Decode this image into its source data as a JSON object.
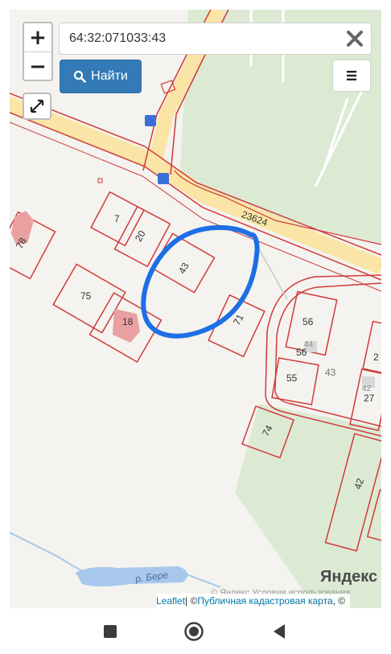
{
  "search": {
    "value": "64:32:071033:43"
  },
  "buttons": {
    "zoom_in": "+",
    "zoom_out": "−",
    "find_label": "Найти"
  },
  "map": {
    "road_label": "23624",
    "river_label": "р. Бере",
    "parcels": [
      "7",
      "20",
      "43",
      "75",
      "18",
      "71",
      "78",
      "56",
      "56",
      "44",
      "43",
      "55",
      "27",
      "42",
      "2",
      "74",
      "42"
    ],
    "parcels_named": {
      "p7": "7",
      "p20": "20",
      "p43": "43",
      "p75": "75",
      "p18": "18",
      "p71": "71",
      "p78": "78",
      "p56a": "56",
      "p56b": "56",
      "p44": "44",
      "p43b": "43",
      "p55": "55",
      "p27": "27",
      "p42a": "42",
      "p2": "2",
      "p74": "74",
      "p42b": "42"
    }
  },
  "attribution": {
    "leaflet": "Leaflet",
    "separator": " | © ",
    "source": "Публичная кадастровая карта",
    "suffix": ", ©"
  },
  "yandex": {
    "logo": "Яндекс",
    "terms": "© Яндекс  Условия использования"
  },
  "colors": {
    "boundary": "#d03a3a",
    "road": "#fbe5a6",
    "highlight": "#1e6fe6",
    "green": "#dcead3",
    "button": "#337ab7"
  }
}
